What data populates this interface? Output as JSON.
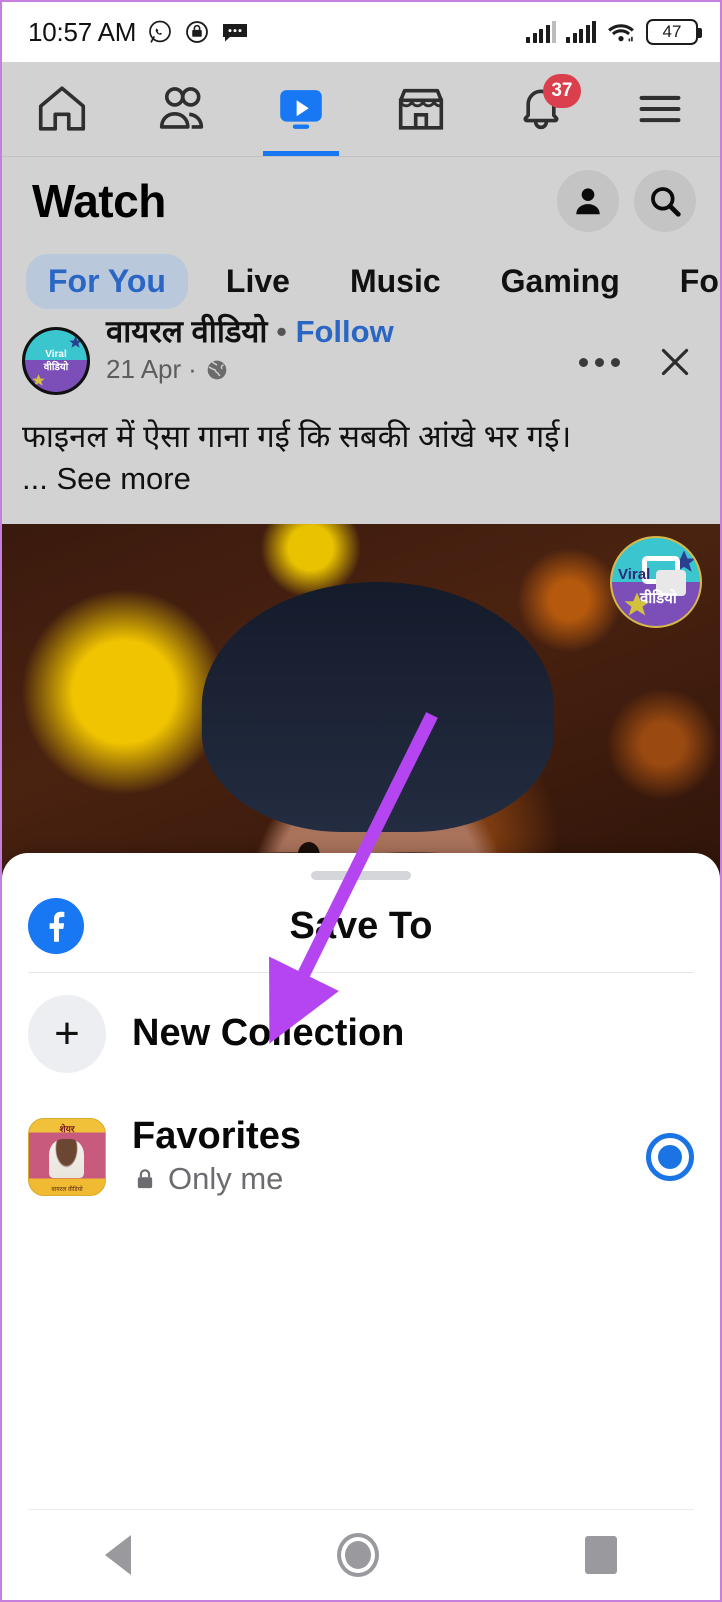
{
  "status_bar": {
    "time": "10:57 AM",
    "icons": [
      "whatsapp-icon",
      "app-notification-icon",
      "message-icon"
    ],
    "signal_1": "signal-bars-icon",
    "signal_2": "signal-bars-icon",
    "wifi": "wifi-icon",
    "battery_level": "47"
  },
  "fb_tabs": [
    {
      "name": "home",
      "icon": "home-icon",
      "active": false,
      "badge": ""
    },
    {
      "name": "friends",
      "icon": "friends-icon",
      "active": false,
      "badge": ""
    },
    {
      "name": "watch",
      "icon": "watch-video-icon",
      "active": true,
      "badge": ""
    },
    {
      "name": "marketplace",
      "icon": "marketplace-icon",
      "active": false,
      "badge": ""
    },
    {
      "name": "notifications",
      "icon": "bell-icon",
      "active": false,
      "badge": "37"
    },
    {
      "name": "menu",
      "icon": "hamburger-menu-icon",
      "active": false,
      "badge": ""
    }
  ],
  "watch": {
    "title": "Watch",
    "profile_icon": "profile-avatar-icon",
    "search_icon": "search-icon",
    "pills": [
      {
        "label": "For You",
        "active": true
      },
      {
        "label": "Live",
        "active": false
      },
      {
        "label": "Music",
        "active": false
      },
      {
        "label": "Gaming",
        "active": false
      },
      {
        "label": "Fo",
        "active": false
      }
    ]
  },
  "post": {
    "page_name": "वायरल वीडियो",
    "separator": "•",
    "follow_label": "Follow",
    "date": "21 Apr",
    "privacy_icon": "globe-icon",
    "more_icon": "three-dots-icon",
    "close_icon": "close-x-icon",
    "body": "फाइनल में ऐसा गाना गई कि सबकी आंखे भर गई।",
    "see_more": "... See more",
    "watermark_top": "Viral",
    "watermark_bottom": "वीडियो"
  },
  "sheet": {
    "brand_icon": "facebook-logo-icon",
    "title": "Save To",
    "rows": [
      {
        "name": "new-collection",
        "icon": "plus-icon",
        "title": "New Collection",
        "subtitle": "",
        "privacy_icon": "",
        "selected": false
      },
      {
        "name": "favorites",
        "icon": "collection-thumbnail",
        "title": "Favorites",
        "subtitle": "Only me",
        "privacy_icon": "lock-icon",
        "selected": true,
        "thumb_top_text": "शेयर",
        "thumb_bottom_text": "वायरल वीडियो"
      }
    ]
  },
  "nav_bar": {
    "back": "back-triangle-icon",
    "home": "home-circle-icon",
    "recents": "recents-square-icon"
  },
  "annotation": {
    "arrow_color": "#b545f0",
    "points_to": "New Collection"
  },
  "colors": {
    "accent_blue": "#1877f2",
    "badge_red": "#d93f4c",
    "pill_active_text": "#2a66c4",
    "pill_active_bg": "#b9c8db",
    "page_bg": "#d2d2d2",
    "sheet_bg": "#ffffff"
  }
}
